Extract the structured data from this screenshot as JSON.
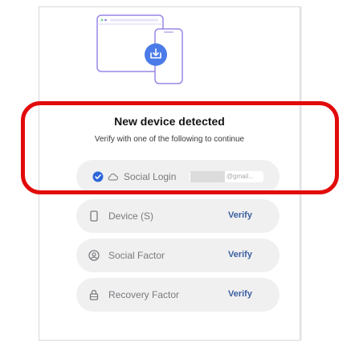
{
  "header": {
    "title": "New device detected",
    "subtitle": "Verify with one of the following to continue"
  },
  "illustration": {
    "icon": "device-download-icon",
    "accent": "#4a7be8",
    "stroke": "#9a86e6"
  },
  "colors": {
    "highlight_border": "#e20b0b",
    "row_bg": "#f0f0f1",
    "verify_link": "#3b5f9e",
    "check": "#2c67d9"
  },
  "factors": [
    {
      "label": "Social Login",
      "icon": "cloud-icon",
      "status": "checked",
      "email_suffix": "@gmail..."
    },
    {
      "label": "Device (S)",
      "icon": "phone-icon",
      "action": "Verify"
    },
    {
      "label": "Social Factor",
      "icon": "user-circle-icon",
      "action": "Verify"
    },
    {
      "label": "Recovery Factor",
      "icon": "lock-icon",
      "action": "Verify"
    }
  ]
}
